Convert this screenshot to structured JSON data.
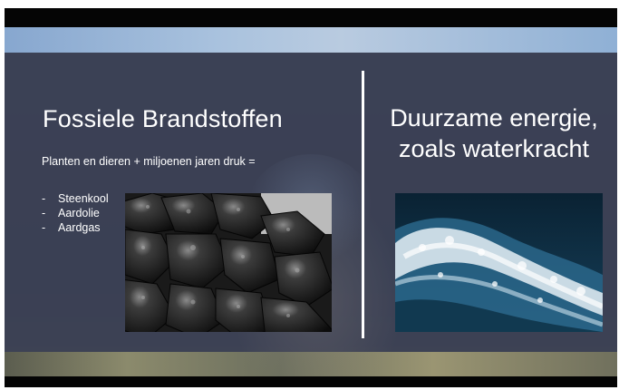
{
  "slide": {
    "left_title": "Fossiele Brandstoffen",
    "left_subtitle": "Planten en dieren + miljoenen jaren druk =",
    "bullets": [
      {
        "dash": "-",
        "label": "Steenkool"
      },
      {
        "dash": "-",
        "label": "Aardolie"
      },
      {
        "dash": "-",
        "label": "Aardgas"
      }
    ],
    "right_title_line1": "Duurzame energie,",
    "right_title_line2": "zoals waterkracht"
  },
  "images": {
    "coal": "coal-photo",
    "water": "water-waves-photo"
  },
  "colors": {
    "overlay": "#3a4054",
    "text": "#ffffff",
    "letterbox": "#050505"
  }
}
